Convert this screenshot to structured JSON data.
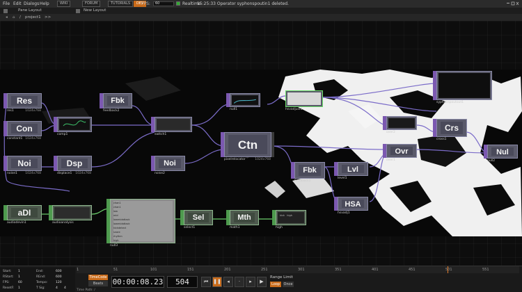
{
  "menu": {
    "file": "File",
    "edit": "Edit",
    "dialogs": "Dialogs",
    "help": "Help",
    "buttons": [
      "WIKI",
      "FORUM",
      "TUTORIALS"
    ],
    "badge": "DEV",
    "fps_label": "FPS:",
    "fps_value": "60",
    "realtime_label": "Realtime",
    "status": "15:25:33 Operator syphonspoutin1 deleted."
  },
  "toolbar": {
    "pane_layout": "Pane Layout",
    "new_layout": "New Layout"
  },
  "path": {
    "root": "/",
    "project": "project1",
    "arrows": ">>"
  },
  "nodes": [
    {
      "id": "res",
      "tag": "Res",
      "name": "res1",
      "res": "1024x768"
    },
    {
      "id": "con",
      "tag": "Con",
      "name": "constant1",
      "res": "1024x768"
    },
    {
      "id": "noi1",
      "tag": "Noi",
      "name": "noise1",
      "res": "1024x768"
    },
    {
      "id": "comp",
      "tag": "",
      "name": "comp1",
      "res": "1024x768"
    },
    {
      "id": "dsp",
      "tag": "Dsp",
      "name": "displace1",
      "res": "1024x768"
    },
    {
      "id": "fbk1",
      "tag": "Fbk",
      "name": "feedback2",
      "res": "1024x768"
    },
    {
      "id": "swit",
      "tag": "",
      "name": "switch1",
      "res": "1024x768"
    },
    {
      "id": "noi2",
      "tag": "Noi",
      "name": "noise2",
      "res": "1024x768"
    },
    {
      "id": "null1",
      "tag": "",
      "name": "null1",
      "res": "1024x768"
    },
    {
      "id": "ctn",
      "tag": "Ctn",
      "name": "pixelrelocator",
      "res": "1024x768"
    },
    {
      "id": "sel1",
      "tag": "",
      "name": "hsvadjust1",
      "res": "1024x768"
    },
    {
      "id": "fbk2",
      "tag": "Fbk",
      "name": "feedback1",
      "res": "1024x768"
    },
    {
      "id": "lvl",
      "tag": "Lvl",
      "name": "level1",
      "res": "1024x768"
    },
    {
      "id": "hsa",
      "tag": "HSA",
      "name": "hsvadj1",
      "res": "1024x768"
    },
    {
      "id": "mid",
      "tag": "",
      "name": "over2",
      "res": "1024x768"
    },
    {
      "id": "ovr",
      "tag": "Ovr",
      "name": "over1",
      "res": "1024x768"
    },
    {
      "id": "crs",
      "tag": "Crs",
      "name": "cross1",
      "res": "1024x768"
    },
    {
      "id": "nul",
      "tag": "Nul",
      "name": "null2",
      "res": "1024x768"
    },
    {
      "id": "out",
      "tag": "",
      "name": "syphonspoutout1",
      "res": "1024x768"
    },
    {
      "id": "adi",
      "tag": "aDI",
      "name": "audiodevin1",
      "res": ""
    },
    {
      "id": "aud",
      "tag": "",
      "name": "audioanalysis",
      "res": ""
    },
    {
      "id": "null3",
      "tag": "",
      "name": "null3",
      "res": ""
    },
    {
      "id": "sel",
      "tag": "Sel",
      "name": "select1",
      "res": ""
    },
    {
      "id": "mth",
      "tag": "Mth",
      "name": "math1",
      "res": ""
    },
    {
      "id": "high",
      "tag": "",
      "name": "high",
      "res": ""
    }
  ],
  "null3_channels": [
    "chan1",
    "chan1",
    "low",
    "mid",
    "lowmidattack",
    "lowmidattack",
    "kickdetect",
    "snare",
    "rhythm",
    "high"
  ],
  "high_values": [
    "kick",
    "high"
  ],
  "timeline": {
    "ticks": [
      "1",
      "51",
      "101",
      "151",
      "201",
      "251",
      "301",
      "351",
      "401",
      "451",
      "501",
      "551"
    ],
    "start_label": "Start:",
    "start": "1",
    "end_label": "End:",
    "end": "600",
    "rstart_label": "RStart:",
    "rstart": "1",
    "rend_label": "REnd:",
    "rend": "600",
    "fps_label": "FPS:",
    "fps": "60",
    "tempo_label": "Tempo:",
    "tempo": "120",
    "reset_label": "ResetF:",
    "reset": "1",
    "tsig_label": "T Sig:",
    "tsig": "4",
    "tsig2": "4",
    "timecode_btn": "TimeCode",
    "beats_btn": "Beats",
    "timecode": "00:00:08.23",
    "frame": "504",
    "range_limit": "Range Limit",
    "loop": "Loop",
    "once": "Once",
    "timepath": "Time Path: /"
  },
  "colors": {
    "top_wire": "#7b6cc9",
    "chop_wire": "#6bd06b",
    "accent": "#c96b1a"
  }
}
